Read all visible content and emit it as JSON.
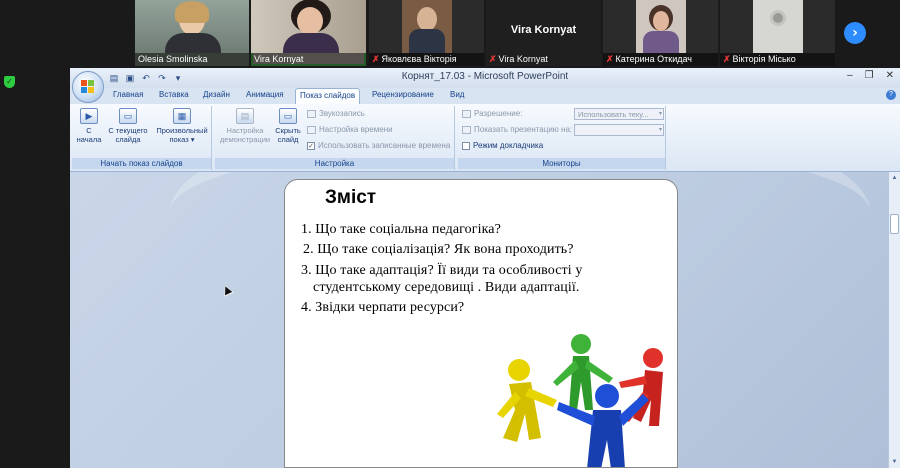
{
  "participants": [
    {
      "name": "Olesia Smolinska",
      "muted": false,
      "icon": "person-video"
    },
    {
      "name": "Vira Kornyat",
      "muted": false,
      "icon": "person-video",
      "active_speaker": true
    },
    {
      "name": "Яковлєва Вікторія",
      "muted": true,
      "icon": "person-video"
    },
    {
      "name": "Vira Kornyat",
      "muted": true,
      "icon": "name-only",
      "big_name": "Vira Kornyat"
    },
    {
      "name": "Катерина Откидач",
      "muted": true,
      "icon": "person-video"
    },
    {
      "name": "Вікторія Місько",
      "muted": true,
      "icon": "person-video"
    }
  ],
  "next_page_icon": "chevron-right-icon",
  "security_icon": "shield-check-icon",
  "ppt": {
    "window_title": "Корнят_17.03 - Microsoft PowerPoint",
    "tabs": [
      "Главная",
      "Вставка",
      "Дизайн",
      "Анимация",
      "Показ слайдов",
      "Рецензирование",
      "Вид"
    ],
    "active_tab": "Показ слайдов",
    "groups": {
      "start": {
        "label": "Начать показ слайдов",
        "from_start": [
          "С",
          "начала"
        ],
        "from_current": [
          "С текущего",
          "слайда"
        ],
        "custom": [
          "Произвольный",
          "показ ▾"
        ]
      },
      "setup": {
        "label": "Настройка",
        "setup_show": [
          "Настройка",
          "демонстрации"
        ],
        "hide_slide": [
          "Скрыть",
          "слайд"
        ],
        "record_narration": "Звукозапись",
        "rehearse": "Настройка времени",
        "use_timings": "Использовать записанные времена"
      },
      "monitors": {
        "label": "Мониторы",
        "resolution": "Разрешение:",
        "resolution_value": "Использовать теку...",
        "show_on": "Показать презентацию на:",
        "show_on_value": "",
        "presenter_view": "Режим докладчика"
      }
    },
    "accent": "#15428b"
  },
  "slide": {
    "title": "Зміст",
    "items": [
      "1. Що таке соціальна педагогіка?",
      "2. Що таке соціалізація?  Як вона проходить?",
      "3. Що таке адаптація?  Її види та особливості у",
      "студентському середовищі . Види адаптації.",
      "4.  Звідки черпати ресурси?"
    ],
    "figure_colors": [
      "#e8d400",
      "#3fb23a",
      "#1f4fd6",
      "#e0312b"
    ]
  }
}
